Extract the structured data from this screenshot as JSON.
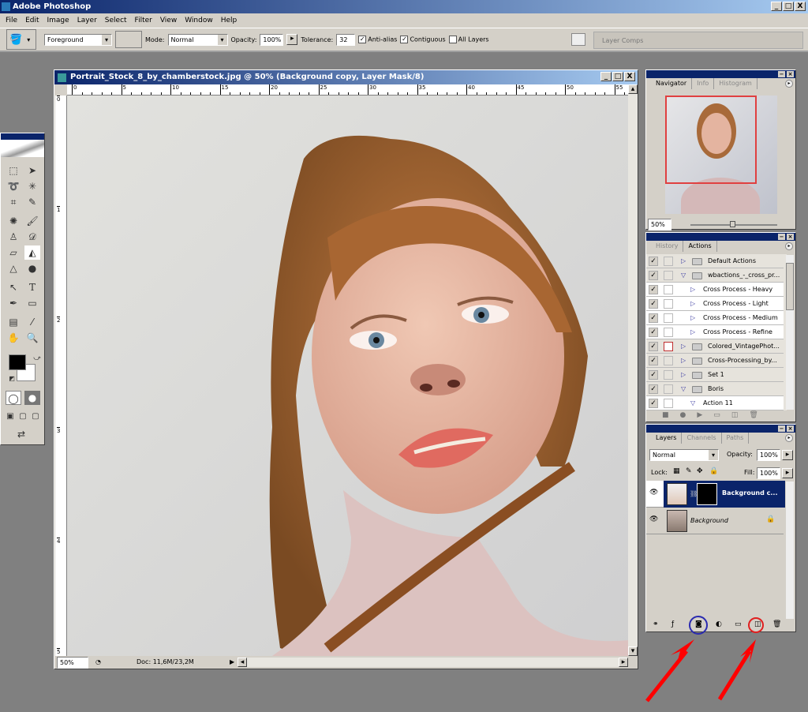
{
  "app": {
    "title": "Adobe Photoshop",
    "window_controls": [
      "_",
      "□",
      "X"
    ]
  },
  "menu": [
    "File",
    "Edit",
    "Image",
    "Layer",
    "Select",
    "Filter",
    "View",
    "Window",
    "Help"
  ],
  "options": {
    "fill_source": "Foreground",
    "mode_label": "Mode:",
    "mode": "Normal",
    "opacity_label": "Opacity:",
    "opacity": "100%",
    "tolerance_label": "Tolerance:",
    "tolerance": "32",
    "anti_alias": "Anti-alias",
    "anti_alias_checked": true,
    "contiguous": "Contiguous",
    "contiguous_checked": true,
    "all_layers": "All Layers",
    "all_layers_checked": false,
    "layer_comps": "Layer Comps"
  },
  "document": {
    "title": "Portrait_Stock_8_by_chamberstock.jpg @ 50% (Background copy, Layer Mask/8)",
    "hruler": [
      "0",
      "5",
      "10",
      "15",
      "20",
      "25",
      "30",
      "35",
      "40",
      "45",
      "50",
      "55"
    ],
    "vruler": [
      "0",
      "1",
      "2",
      "3",
      "4",
      "5"
    ],
    "zoom": "50%",
    "doc_info": "Doc: 11,6M/23,2M"
  },
  "navigator": {
    "tabs": [
      "Navigator",
      "Info",
      "Histogram"
    ],
    "zoom": "50%",
    "view_fraction": 0.6
  },
  "actions": {
    "tabs": [
      "History",
      "Actions"
    ],
    "rows": [
      {
        "label": "Default Actions",
        "type": "set",
        "expanded": false,
        "checked": true
      },
      {
        "label": "wbactions_-_cross_pr...",
        "type": "set",
        "expanded": true,
        "checked": true
      },
      {
        "label": "Cross Process - Heavy",
        "type": "action",
        "checked": true
      },
      {
        "label": "Cross Process - Light",
        "type": "action",
        "checked": true
      },
      {
        "label": "Cross Process - Medium",
        "type": "action",
        "checked": true
      },
      {
        "label": "Cross Process - Refine",
        "type": "action",
        "checked": true
      },
      {
        "label": "Colored_VintagePhot...",
        "type": "set",
        "expanded": false,
        "checked": true,
        "dialog": true
      },
      {
        "label": "Cross-Processing_by...",
        "type": "set",
        "expanded": false,
        "checked": true
      },
      {
        "label": "Set 1",
        "type": "set",
        "expanded": false,
        "checked": true
      },
      {
        "label": "Boris",
        "type": "set",
        "expanded": true,
        "checked": true
      },
      {
        "label": "Action 11",
        "type": "action",
        "expanded": true,
        "checked": true
      }
    ]
  },
  "layers": {
    "tabs": [
      "Layers",
      "Channels",
      "Paths"
    ],
    "blend": "Normal",
    "opacity_label": "Opacity:",
    "opacity": "100%",
    "lock_label": "Lock:",
    "fill_label": "Fill:",
    "fill": "100%",
    "items": [
      {
        "name": "Background c...",
        "selected": true,
        "mask": true
      },
      {
        "name": "Background",
        "selected": false,
        "locked": true
      }
    ]
  },
  "annotations": {
    "circle_mask_color": "#2a2ab0",
    "circle_new_color": "#e02020",
    "arrow_color": "#ff0000"
  }
}
